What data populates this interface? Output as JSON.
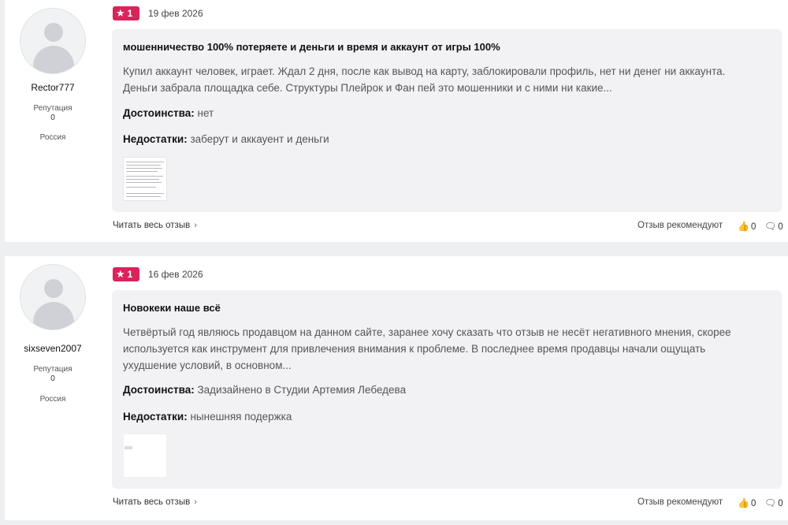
{
  "reviews": [
    {
      "author": {
        "name": "Rector777",
        "reputation_label": "Репутация",
        "reputation": "0",
        "country": "Россия"
      },
      "rating": "1",
      "date": "19 фев 2026",
      "title": "мошенничество 100% потеряете и деньги и время и аккаунт от игры 100%",
      "text_line1": "Купил аккаунт человек, играет. Ждал 2 дня, после как вывод на карту, заблокировали профиль, нет ни денег ни аккаунта.",
      "text_line2": "Деньги забрала площадка себе. Структуры Плейрок и Фан пей это мошенники и с ними ни какие...",
      "pros_label": "Достоинства:",
      "pros": "нет",
      "cons_label": "Недостатки:",
      "cons": "заберут и аккауент и деньги",
      "read_more": "Читать весь отзыв",
      "recommend_label": "Отзыв рекомендуют",
      "likes": "0",
      "comments": "0"
    },
    {
      "author": {
        "name": "sixseven2007",
        "reputation_label": "Репутация",
        "reputation": "0",
        "country": "Россия"
      },
      "rating": "1",
      "date": "16 фев 2026",
      "title": "Новокеки наше всё",
      "text_line1": "Четвёртый год являюсь продавцом на данном сайте, заранее хочу сказать что отзыв не несёт негативного мнения, скорее",
      "text_line2": "используется как инструмент для привлечения внимания к проблеме. В последнее время продавцы начали ощущать",
      "text_line3": "ухудшение условий, в основном...",
      "pros_label": "Достоинства:",
      "pros": "Задизайнено в Студии Артемия Лебедева",
      "cons_label": "Недостатки:",
      "cons": "нынешняя подержка",
      "read_more": "Читать весь отзыв",
      "recommend_label": "Отзыв рекомендуют",
      "likes": "0",
      "comments": "0"
    }
  ],
  "icons": {
    "rating": "star-icon",
    "like": "thumbs-up-icon",
    "comment": "comment-icon",
    "more": "chevron-right-icon",
    "avatar": "user-placeholder-icon"
  },
  "colors": {
    "rating_badge": "#d9245b",
    "card_bg": "#f2f2f4",
    "page_bg": "#eeeff1"
  }
}
